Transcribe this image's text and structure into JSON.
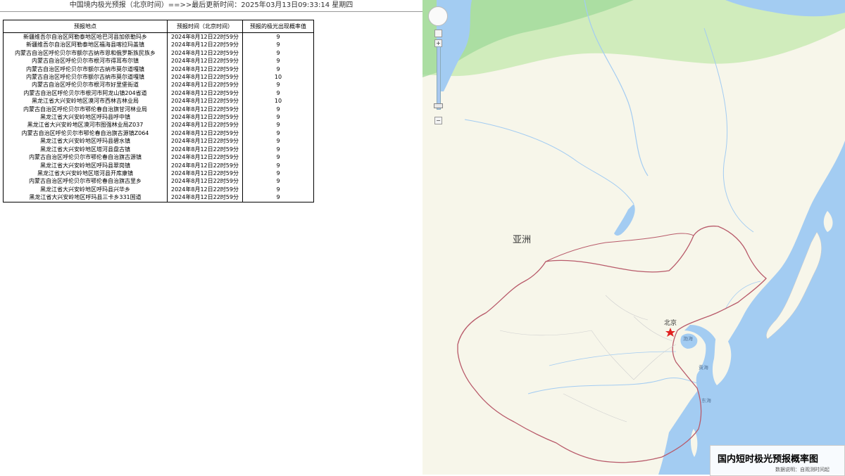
{
  "header": {
    "title": "中国境内极光预报（北京时间）==>>最后更新时间：2025年03月13日09:33:14   星期四"
  },
  "table": {
    "columns": [
      "预报地点",
      "预报时间（北京时间）",
      "预报的极光出现概率值"
    ],
    "rows": [
      [
        "新疆维吾尔自治区阿勒泰地区哈巴河县加依勒玛乡",
        "2024年8月12日22时59分",
        "9"
      ],
      [
        "新疆维吾尔自治区阿勒泰地区福海县喀拉玛盖镇",
        "2024年8月12日22时59分",
        "9"
      ],
      [
        "内蒙古自治区呼伦贝尔市额尔古纳市恩和俄罗斯族民族乡",
        "2024年8月12日22时59分",
        "9"
      ],
      [
        "内蒙古自治区呼伦贝尔市根河市得耳布尔镇",
        "2024年8月12日22时59分",
        "9"
      ],
      [
        "内蒙古自治区呼伦贝尔市额尔古纳市莫尔道嘎镇",
        "2024年8月12日22时59分",
        "9"
      ],
      [
        "内蒙古自治区呼伦贝尔市额尔古纳市莫尔道嘎镇",
        "2024年8月12日22时59分",
        "10"
      ],
      [
        "内蒙古自治区呼伦贝尔市根河市好里堡街道",
        "2024年8月12日22时59分",
        "9"
      ],
      [
        "内蒙古自治区呼伦贝尔市根河市阿龙山镇204省道",
        "2024年8月12日22时59分",
        "9"
      ],
      [
        "黑龙江省大兴安岭地区漠河市西林吉林业局",
        "2024年8月12日22时59分",
        "10"
      ],
      [
        "内蒙古自治区呼伦贝尔市鄂伦春自治旗甘河林业局",
        "2024年8月12日22时59分",
        "9"
      ],
      [
        "黑龙江省大兴安岭地区呼玛县呼中镇",
        "2024年8月12日22时59分",
        "9"
      ],
      [
        "黑龙江省大兴安岭地区漠河市图强林业局Z037",
        "2024年8月12日22时59分",
        "9"
      ],
      [
        "内蒙古自治区呼伦贝尔市鄂伦春自治旗古源镇Z064",
        "2024年8月12日22时59分",
        "9"
      ],
      [
        "黑龙江省大兴安岭地区呼玛县碧水镇",
        "2024年8月12日22时59分",
        "9"
      ],
      [
        "黑龙江省大兴安岭地区塔河县盘古镇",
        "2024年8月12日22时59分",
        "9"
      ],
      [
        "内蒙古自治区呼伦贝尔市鄂伦春自治旗古源镇",
        "2024年8月12日22时59分",
        "9"
      ],
      [
        "黑龙江省大兴安岭地区呼玛县翠岗镇",
        "2024年8月12日22时59分",
        "9"
      ],
      [
        "黑龙江省大兴安岭地区塔河县开库康镇",
        "2024年8月12日22时59分",
        "9"
      ],
      [
        "内蒙古自治区呼伦贝尔市鄂伦春自治旗古里乡",
        "2024年8月12日22时59分",
        "9"
      ],
      [
        "黑龙江省大兴安岭地区呼玛县兴华乡",
        "2024年8月12日22时59分",
        "9"
      ],
      [
        "黑龙江省大兴安岭地区呼玛县三卡乡331国道",
        "2024年8月12日22时59分",
        "9"
      ]
    ]
  },
  "map": {
    "controls": {
      "pan_icon": "pan-compass-icon",
      "zoom_in_label": "+",
      "zoom_out_label": "−",
      "zoom_level_fraction": 0.05
    },
    "labels": {
      "asia": "亚洲",
      "beijing": "北京",
      "bohai": "渤海",
      "yellow_sea": "黄海",
      "east_sea": "东海"
    },
    "legend": {
      "title": "国内短时极光预报概率图",
      "note": "数据说明：自观测时间起"
    },
    "colors": {
      "land": "#f7f6ea",
      "water": "#a3ccf2",
      "border": "#b85a6a",
      "aurora_green": "#9fd99a",
      "capital_star": "#e02020"
    }
  }
}
